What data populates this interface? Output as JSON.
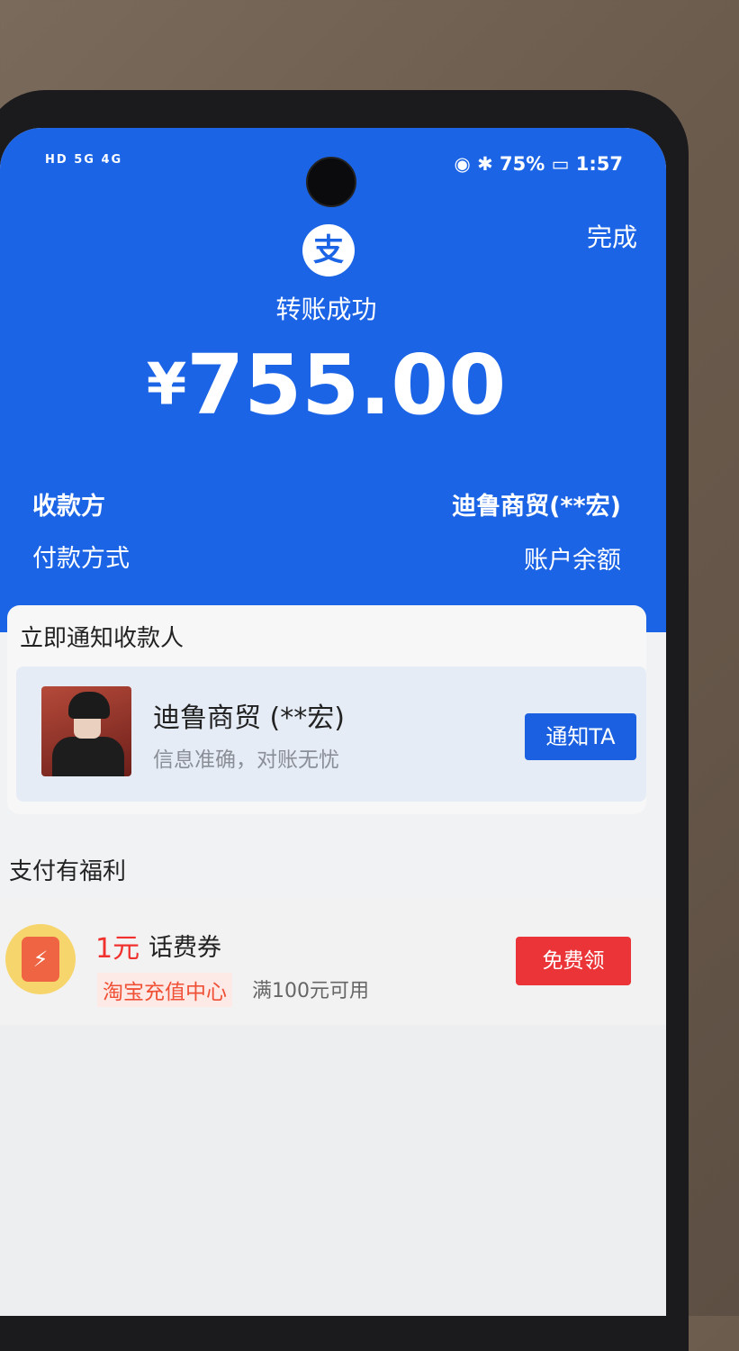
{
  "status_bar": {
    "left_indicators": "HD 5G 4G",
    "right_indicators": "75%",
    "time": "1:57"
  },
  "header": {
    "done_label": "完成",
    "logo_glyph": "支",
    "title": "转账成功",
    "currency": "¥",
    "amount": "755.00"
  },
  "info": {
    "payee_label": "收款方",
    "payee_value": "迪鲁商贸(**宏)",
    "method_label": "付款方式",
    "method_value": "账户余额"
  },
  "notify_card": {
    "title": "立即通知收款人",
    "payee_name": "迪鲁商贸 (**宏)",
    "payee_sub": "信息准确，对账无忧",
    "button_label": "通知TA"
  },
  "benefits": {
    "title": "支付有福利",
    "coupon_amount": "1元",
    "coupon_name": "话费券",
    "source_tag": "淘宝充值中心",
    "condition": "满100元可用",
    "button_label": "免费领",
    "icon_glyph": "⚡"
  },
  "colors": {
    "primary_blue": "#1c64e6",
    "accent_red": "#ea3438"
  }
}
